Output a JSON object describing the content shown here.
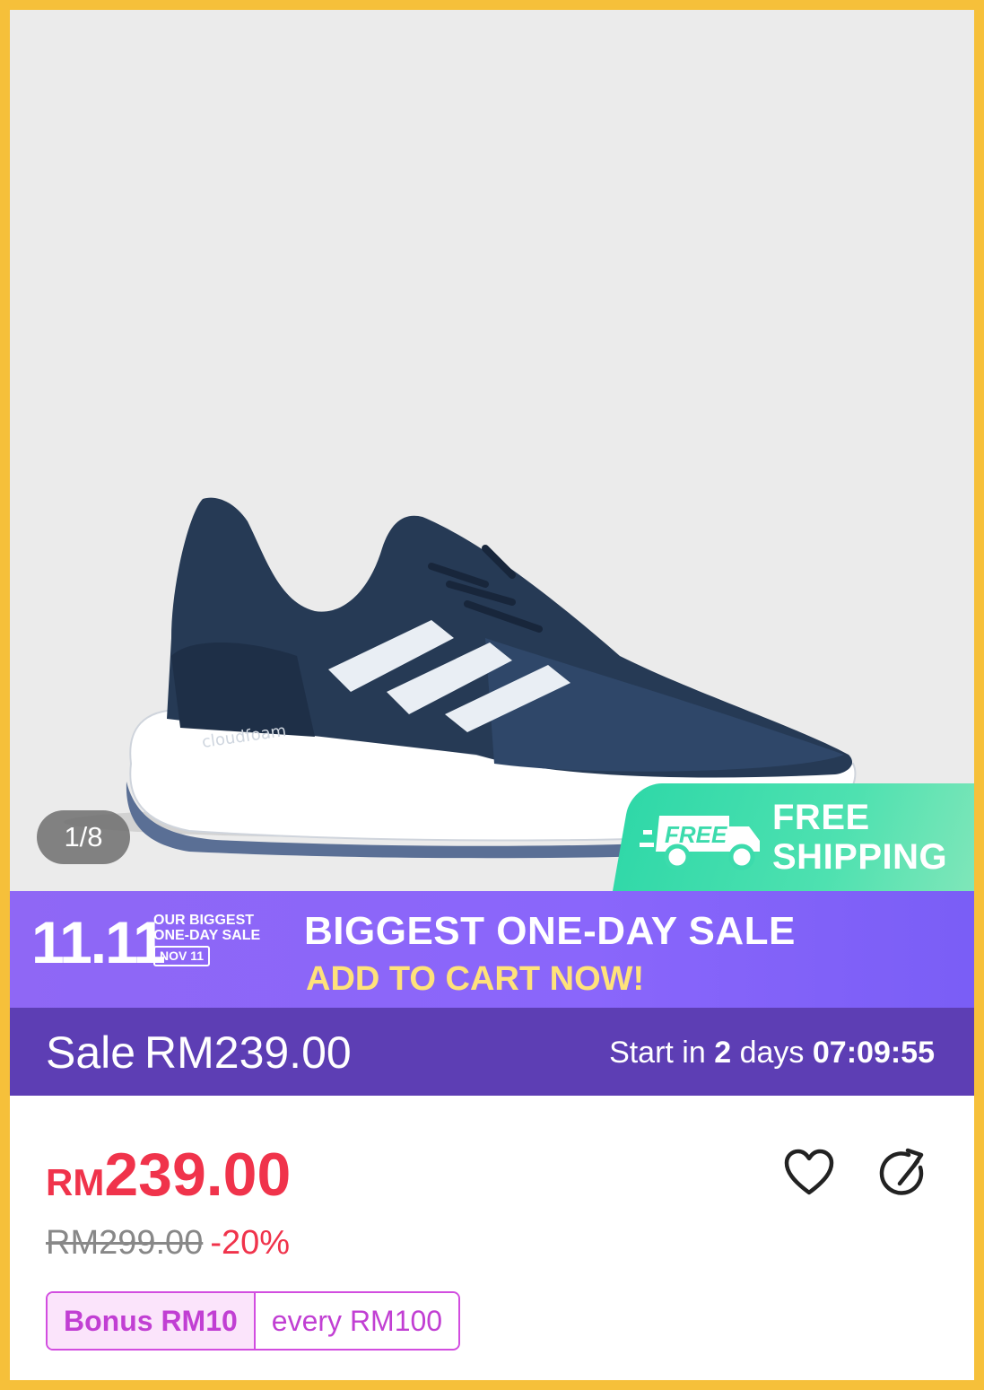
{
  "gallery": {
    "counter": "1/8",
    "shoe_color": "#263a55",
    "background": "#ebebeb"
  },
  "free_shipping": {
    "truck_label": "FREE",
    "line1": "FREE",
    "line2": "SHIPPING",
    "color": "#3cdbac"
  },
  "campaign": {
    "logo": "11.11",
    "logo_line1": "OUR BIGGEST",
    "logo_line2": "ONE-DAY SALE",
    "logo_badge": "NOV 11",
    "title": "BIGGEST ONE-DAY SALE",
    "subtitle": "ADD TO CART NOW!",
    "color": "#8a66fb"
  },
  "sale_strip": {
    "label": "Sale",
    "price": "RM239.00",
    "start_prefix": "Start in",
    "days_count": "2",
    "days_label": "days",
    "time": "07:09:55",
    "color": "#5d3eb4"
  },
  "price": {
    "currency": "RM",
    "amount": "239.00",
    "original": "RM299.00",
    "discount": "-20%",
    "color": "#f0334b"
  },
  "bonus": {
    "left": "Bonus RM10",
    "right": "every RM100"
  },
  "actions": {
    "wishlist_icon": "heart-icon",
    "share_icon": "share-icon"
  }
}
